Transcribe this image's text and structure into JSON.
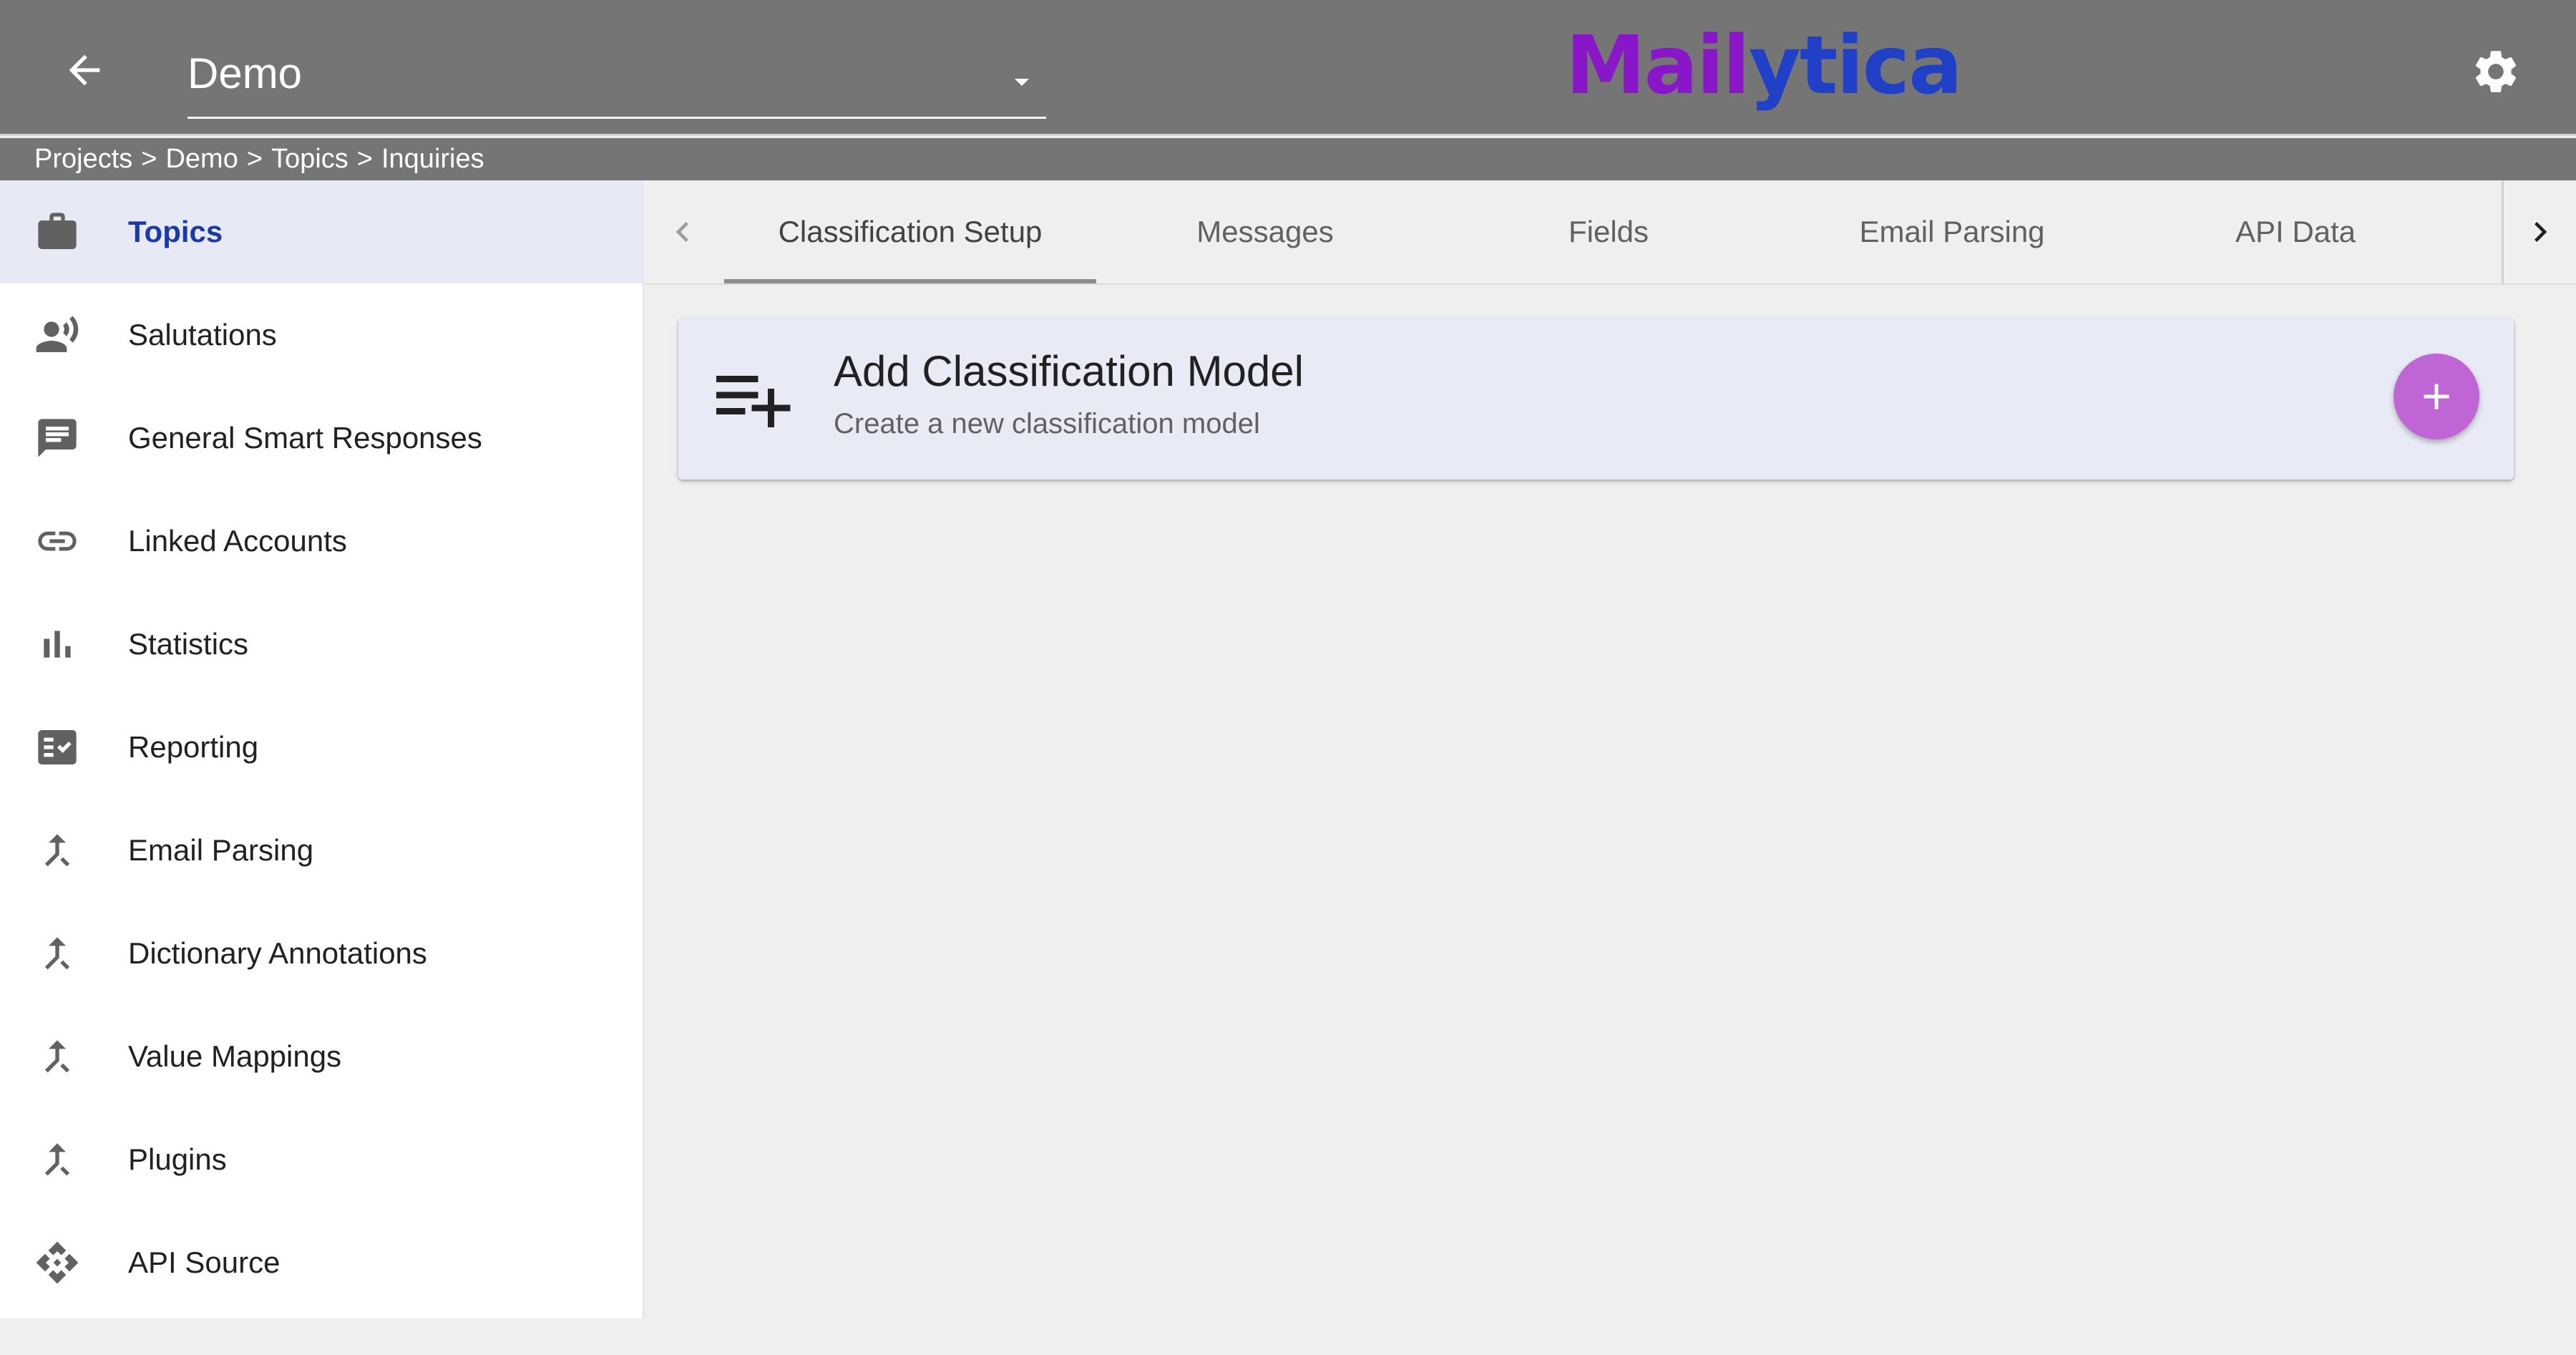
{
  "header": {
    "project_selected": "Demo",
    "logo": {
      "part1": "Mail",
      "part2": "ytica",
      "color1": "#8a16c9",
      "color2": "#2040c8"
    },
    "icons": {
      "back": "arrow-left-icon",
      "dropdown": "caret-down-icon",
      "settings": "gear-icon"
    },
    "background": "#757575"
  },
  "breadcrumb": {
    "items": [
      "Projects",
      "Demo",
      "Topics",
      "Inquiries"
    ],
    "separator": ">"
  },
  "sidebar": {
    "items": [
      {
        "label": "Topics",
        "icon": "briefcase-icon",
        "active": true
      },
      {
        "label": "Salutations",
        "icon": "person-voice-icon"
      },
      {
        "label": "General Smart Responses",
        "icon": "chat-message-icon"
      },
      {
        "label": "Linked Accounts",
        "icon": "link-icon"
      },
      {
        "label": "Statistics",
        "icon": "bar-chart-icon"
      },
      {
        "label": "Reporting",
        "icon": "checklist-icon"
      },
      {
        "label": "Email Parsing",
        "icon": "merge-arrow-icon"
      },
      {
        "label": "Dictionary Annotations",
        "icon": "merge-arrow-icon"
      },
      {
        "label": "Value Mappings",
        "icon": "merge-arrow-icon"
      },
      {
        "label": "Plugins",
        "icon": "merge-arrow-icon"
      },
      {
        "label": "API Source",
        "icon": "api-diamond-icon"
      }
    ],
    "active_color": "#1a3aa8",
    "active_background": "#e7e9f4"
  },
  "tabs": {
    "items": [
      {
        "label": "Classification Setup",
        "active": true
      },
      {
        "label": "Messages"
      },
      {
        "label": "Fields"
      },
      {
        "label": "Email Parsing"
      },
      {
        "label": "API Data"
      }
    ],
    "icons": {
      "scroll_left": "chevron-left-icon",
      "scroll_right": "chevron-right-icon"
    }
  },
  "card": {
    "title": "Add Classification Model",
    "subtitle": "Create a new classification model",
    "icon": "playlist-add-icon",
    "action_icon": "plus-icon",
    "action_color": "#c065d6",
    "background": "#e8eaf5"
  }
}
